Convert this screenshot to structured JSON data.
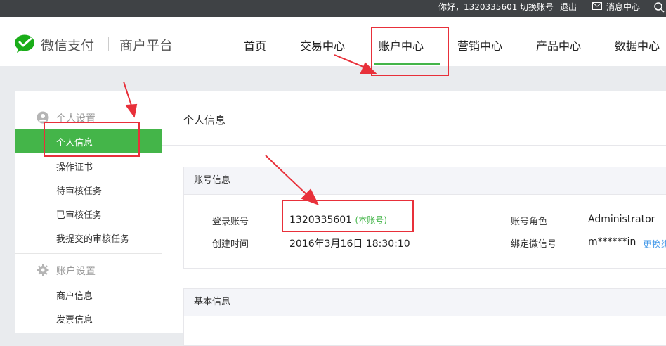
{
  "topbar": {
    "greeting": "你好，1320335601",
    "switch_account": "切换账号",
    "logout": "退出",
    "messages": "消息中心"
  },
  "header": {
    "brand": "微信支付",
    "brand_sub": "商户平台",
    "nav": [
      "首页",
      "交易中心",
      "账户中心",
      "营销中心",
      "产品中心",
      "数据中心"
    ],
    "active_nav": "账户中心",
    "accent": "#44b549"
  },
  "sidebar": {
    "section1_title": "个人设置",
    "section1_items": [
      "个人信息",
      "操作证书",
      "待审核任务",
      "已审核任务",
      "我提交的审核任务"
    ],
    "active_item": "个人信息",
    "section2_title": "账户设置",
    "section2_items": [
      "商户信息",
      "发票信息"
    ]
  },
  "main": {
    "page_title": "个人信息",
    "account_panel": {
      "title": "账号信息",
      "login_account_label": "登录账号",
      "login_account_value": "1320335601",
      "login_account_badge": "(本账号)",
      "created_label": "创建时间",
      "created_value": "2016年3月16日 18:30:10",
      "role_label": "账号角色",
      "role_value": "Administrator",
      "wechat_label": "绑定微信号",
      "wechat_value": "m******in",
      "change_link": "更换绑"
    },
    "basic_panel": {
      "title": "基本信息"
    }
  },
  "icons": {
    "logo": "wechat-pay-logo",
    "messages": "envelope-icon",
    "search": "search-icon",
    "person_settings": "user-icon",
    "account_settings": "gear-icon"
  },
  "annotation_color": "#e8303a"
}
